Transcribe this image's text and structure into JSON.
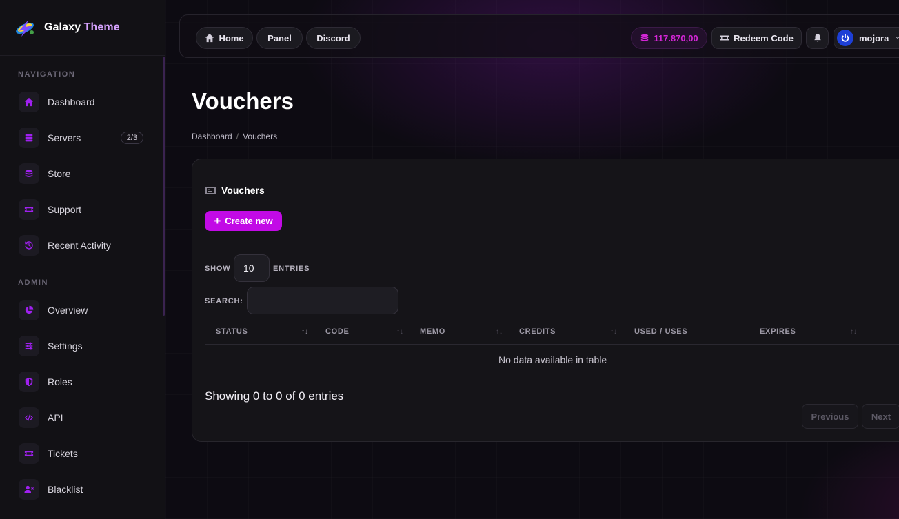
{
  "brand": {
    "name_part1": "Galaxy",
    "name_part2": "Theme"
  },
  "sidebar": {
    "sections": [
      {
        "label": "NAVIGATION"
      },
      {
        "label": "ADMIN"
      }
    ],
    "items": [
      {
        "label": "Dashboard",
        "icon": "home-icon"
      },
      {
        "label": "Servers",
        "icon": "server-icon",
        "badge": "2/3"
      },
      {
        "label": "Store",
        "icon": "coins-icon"
      },
      {
        "label": "Support",
        "icon": "ticket-icon"
      },
      {
        "label": "Recent Activity",
        "icon": "history-icon"
      },
      {
        "label": "Overview",
        "icon": "pie-chart-icon"
      },
      {
        "label": "Settings",
        "icon": "sliders-icon"
      },
      {
        "label": "Roles",
        "icon": "shield-icon"
      },
      {
        "label": "API",
        "icon": "code-icon"
      },
      {
        "label": "Tickets",
        "icon": "ticket-icon"
      },
      {
        "label": "Blacklist",
        "icon": "user-block-icon"
      }
    ]
  },
  "topbar": {
    "home": "Home",
    "panel": "Panel",
    "discord": "Discord",
    "credits": "117.870,00",
    "redeem": "Redeem Code",
    "username": "mojora"
  },
  "page": {
    "title": "Vouchers",
    "breadcrumb": [
      "Dashboard",
      "Vouchers"
    ]
  },
  "card": {
    "title": "Vouchers",
    "create_label": "Create new",
    "show_label": "SHOW",
    "entries_label": "ENTRIES",
    "show_value": "10",
    "search_label": "SEARCH:",
    "columns": [
      "STATUS",
      "CODE",
      "MEMO",
      "CREDITS",
      "USED / USES",
      "EXPIRES"
    ],
    "empty_text": "No data available in table",
    "showing_text": "Showing 0 to 0 of 0 entries",
    "previous": "Previous",
    "next": "Next"
  },
  "colors": {
    "accent": "#c20ae6",
    "credits_text": "#d426d6",
    "icon_purple": "#a020f0"
  }
}
